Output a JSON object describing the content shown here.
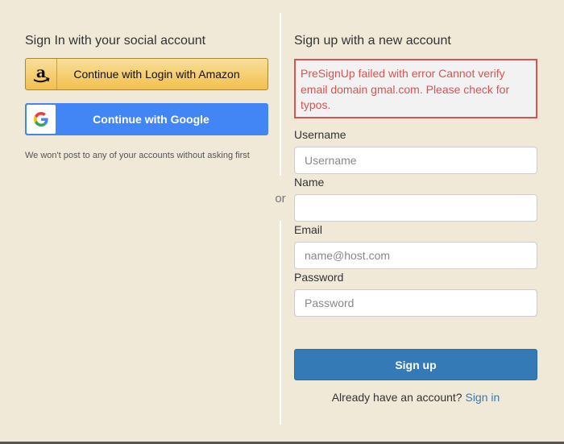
{
  "social": {
    "heading": "Sign In with your social account",
    "amazon_label": "Continue with Login with Amazon",
    "google_label": "Continue with Google",
    "note": "We won't post to any of your accounts without asking first"
  },
  "divider": {
    "or_text": "or"
  },
  "signup": {
    "heading": "Sign up with a new account",
    "error": "PreSignUp failed with error Cannot verify email domain gmal.com. Please check for typos.",
    "username_label": "Username",
    "username_placeholder": "Username",
    "name_label": "Name",
    "name_placeholder": "",
    "email_label": "Email",
    "email_placeholder": "name@host.com",
    "password_label": "Password",
    "password_placeholder": "Password",
    "submit_label": "Sign up",
    "have_account_text": "Already have an account?",
    "signin_link": "Sign in"
  },
  "colors": {
    "background": "#f1e9d8",
    "primary": "#337ab7",
    "error": "#d9534f",
    "google": "#4285f4",
    "amazon": "#f2c04e"
  },
  "icons": {
    "amazon": "amazon-logo-icon",
    "google": "google-logo-icon"
  }
}
